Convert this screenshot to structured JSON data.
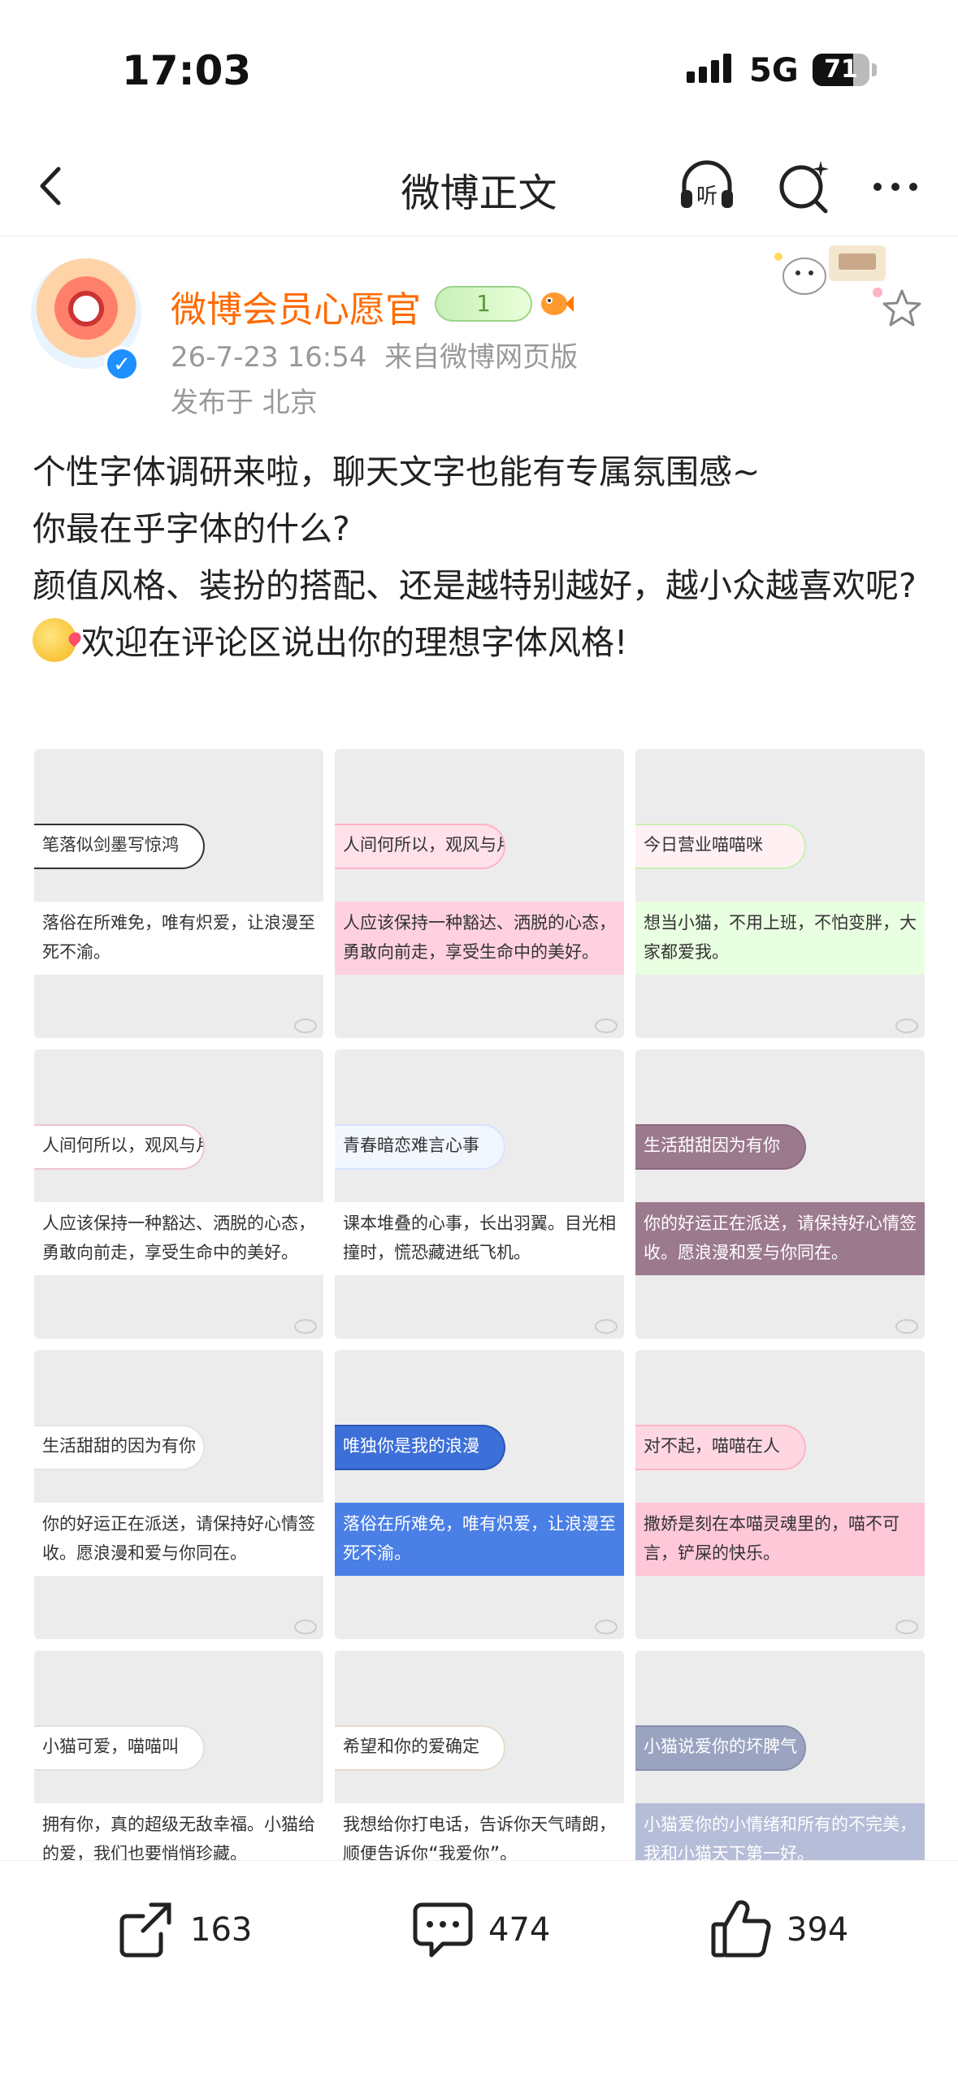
{
  "status_bar": {
    "time": "17:03",
    "network": "5G",
    "battery": "71",
    "battery_level": 0.71
  },
  "nav": {
    "title": "微博正文",
    "listen_label": "听"
  },
  "post": {
    "username": "微博会员心愿官",
    "level_badge": "1",
    "timestamp": "26-7-23 16:54",
    "source": "来自微博网页版",
    "location": "发布于 北京",
    "lines": [
      "个性字体调研来啦，聊天文字也能有专属氛围感~",
      "你最在乎字体的什么?",
      "颜值风格、装扮的搭配、还是越特别越好，越小众越喜欢呢?",
      "欢迎在评论区说出你的理想字体风格!"
    ]
  },
  "tiles": [
    {
      "line1": "笔落似剑墨写惊鸿",
      "line2": "落俗在所难免，唯有炽爱，让浪漫至死不渝。",
      "c1": "#ffffff",
      "c2": "#ffffff",
      "b1": "#333333"
    },
    {
      "line1": "人间何所以，观风与月舒",
      "line2": "人应该保持一种豁达、洒脱的心态，勇敢向前走，享受生命中的美好。",
      "c1": "#ffe1ea",
      "c2": "#ffd1e0",
      "b1": "#ffb3c8"
    },
    {
      "line1": "今日营业喵喵咪",
      "line2": "想当小猫，不用上班，不怕变胖，大家都爱我。",
      "c1": "#fff0f3",
      "c2": "#e9ffe1",
      "b1": "#c9f0b5"
    },
    {
      "line1": "人间何所以，观风与月舒",
      "line2": "人应该保持一种豁达、洒脱的心态，勇敢向前走，享受生命中的美好。",
      "c1": "#ffffff",
      "c2": "#ffffff",
      "b1": "#f0c4cf"
    },
    {
      "line1": "青春暗恋难言心事",
      "line2": "课本堆叠的心事，长出羽翼。目光相撞时，慌恐藏进纸飞机。",
      "c1": "#f2f6ff",
      "c2": "#ffffff",
      "b1": "#d7e4ff"
    },
    {
      "line1": "生活甜甜因为有你",
      "line2": "你的好运正在派送，请保持好心情签收。愿浪漫和爱与你同在。",
      "c1": "#9c7a8e",
      "c2": "#9c7a8e",
      "b1": "#8b6a7e"
    },
    {
      "line1": "生活甜甜的因为有你",
      "line2": "你的好运正在派送，请保持好心情签收。愿浪漫和爱与你同在。",
      "c1": "#ffffff",
      "c2": "#ffffff",
      "b1": "#e4e4e4"
    },
    {
      "line1": "唯独你是我的浪漫",
      "line2": "落俗在所难免，唯有炽爱，让浪漫至死不渝。",
      "c1": "#3c6fd8",
      "c2": "#4a7fe6",
      "b1": "#2a55b8"
    },
    {
      "line1": "对不起，喵喵在人",
      "line2": "撒娇是刻在本喵灵魂里的，喵不可言，铲屎的快乐。",
      "c1": "#ffd7e2",
      "c2": "#ffc8d8",
      "b1": "#ffb3c6"
    },
    {
      "line1": "小猫可爱，喵喵叫",
      "line2": "拥有你，真的超级无敌幸福。小猫给的爱，我们也要悄悄珍藏。",
      "c1": "#ffffff",
      "c2": "#ffffff",
      "b1": "#e0e0e0"
    },
    {
      "line1": "希望和你的爱确定",
      "line2": "我想给你打电话，告诉你天气晴朗，顺便告诉你“我爱你”。",
      "c1": "#ffffff",
      "c2": "#ffffff",
      "b1": "#e6dccd"
    },
    {
      "line1": "小猫说爱你的坏脾气",
      "line2": "小猫爱你的小情绪和所有的不完美，我和小猫天下第一好。",
      "c1": "#9aa3c0",
      "c2": "#b5bdd8",
      "b1": "#8790b0"
    }
  ],
  "actions": {
    "share": "163",
    "comment": "474",
    "like": "394"
  }
}
